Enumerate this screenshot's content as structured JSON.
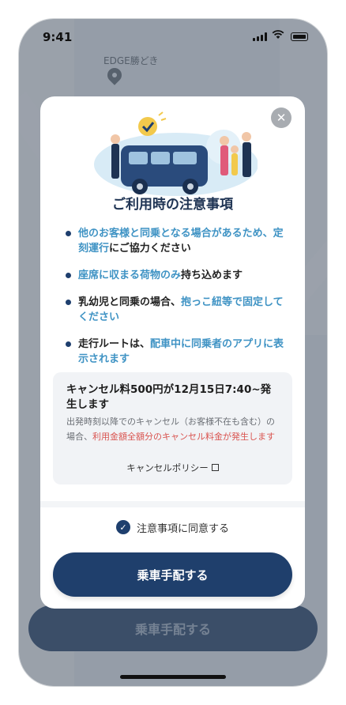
{
  "status_bar": {
    "time": "9:41"
  },
  "map": {
    "label": "EDGE勝どき"
  },
  "underlying": {
    "button_label": "乗車手配する"
  },
  "modal": {
    "title": "ご利用時の注意事項",
    "notes": [
      {
        "parts": [
          {
            "text": "他のお客様と同乗となる場合があるため、定刻運行",
            "highlight": true
          },
          {
            "text": "にご協力ください",
            "highlight": false
          }
        ]
      },
      {
        "parts": [
          {
            "text": "座席に収まる荷物のみ",
            "highlight": true
          },
          {
            "text": "持ち込めます",
            "highlight": false
          }
        ]
      },
      {
        "parts": [
          {
            "text": "乳幼児と同乗の場合、",
            "highlight": false
          },
          {
            "text": "抱っこ紐等で固定してください",
            "highlight": true
          }
        ]
      },
      {
        "parts": [
          {
            "text": "走行ルートは、",
            "highlight": false
          },
          {
            "text": "配車中に同乗者のアプリに表示されます",
            "highlight": true
          }
        ]
      }
    ],
    "cancel": {
      "heading": "キャンセル料500円が12月15日7:40~発生します",
      "body_prefix": "出発時刻以降でのキャンセル（お客様不在も含む）の場合、",
      "body_highlight": "利用金額全額分のキャンセル料金が発生します",
      "policy_link": "キャンセルポリシー"
    },
    "agree_label": "注意事項に同意する",
    "cta_label": "乗車手配する"
  },
  "colors": {
    "primary": "#1f3f6c",
    "highlight": "#3f93c4",
    "warning": "#d9534f"
  }
}
